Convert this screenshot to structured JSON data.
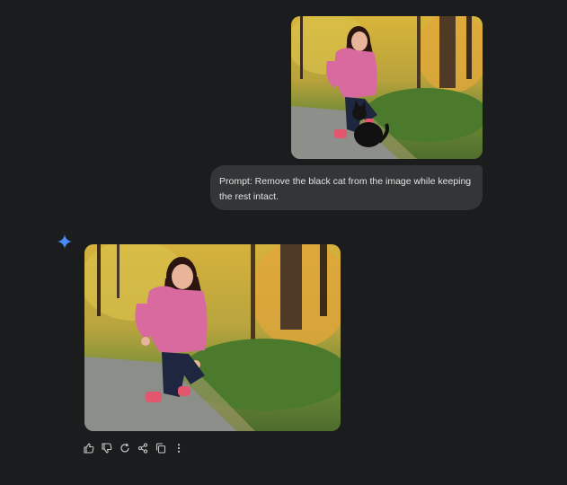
{
  "conversation": {
    "user_message": {
      "image_description": "woman-with-black-cat-photo",
      "prompt_text": "Prompt: Remove the black cat from the image while keeping the rest intact."
    },
    "response": {
      "logo_icon": "gemini-sparkle-icon",
      "image_description": "woman-without-cat-photo",
      "actions": [
        {
          "icon": "thumbs-up-icon"
        },
        {
          "icon": "thumbs-down-icon"
        },
        {
          "icon": "regenerate-icon"
        },
        {
          "icon": "share-icon"
        },
        {
          "icon": "copy-icon"
        },
        {
          "icon": "more-options-icon"
        }
      ]
    }
  },
  "colors": {
    "background": "#1b1c1d",
    "bubble": "#333537",
    "bubble_text": "#e3e3e3",
    "sparkle": "#4a8cf7",
    "action_icon": "#c4c7c5"
  }
}
